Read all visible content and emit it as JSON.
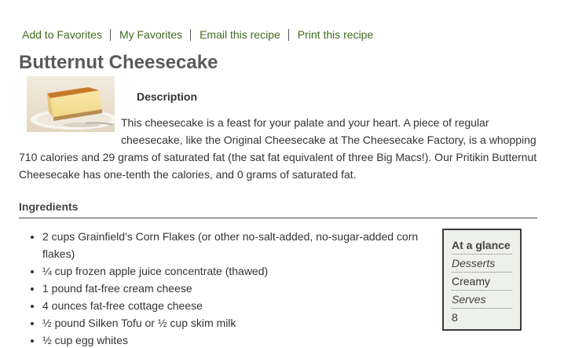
{
  "actions": {
    "add_favorites": "Add to Favorites",
    "my_favorites": "My Favorites",
    "email": "Email this recipe",
    "print": "Print this recipe"
  },
  "recipe": {
    "title": "Butternut Cheesecake",
    "photo_icon": "cheesecake-photo",
    "description_heading": "Description",
    "description": "This cheesecake is a feast for your palate and your heart. A piece of regular cheesecake, like the Original Cheesecake at The Cheesecake Factory, is a whopping 710 calories and 29 grams of saturated fat (the sat fat equivalent of three Big Macs!). Our Pritikin Butternut Cheesecake has one-tenth the calories, and 0 grams of saturated fat."
  },
  "ingredients": {
    "heading": "Ingredients",
    "items": [
      "2 cups Grainfield's Corn Flakes (or other no-salt-added, no-sugar-added corn flakes)",
      "¼ cup frozen apple juice concentrate (thawed)",
      "1 pound fat-free cream cheese",
      "4 ounces fat-free cottage cheese",
      "½ pound Silken Tofu or ½ cup skim milk",
      "½ cup egg whites"
    ]
  },
  "glance": {
    "title": "At a glance",
    "category_label": "Desserts",
    "category_value": "Creamy",
    "serves_label": "Serves",
    "serves_value": "8"
  },
  "colors": {
    "link": "#3d6a1f",
    "title": "#5a5a5a",
    "glance_bg": "#eef0ea"
  }
}
